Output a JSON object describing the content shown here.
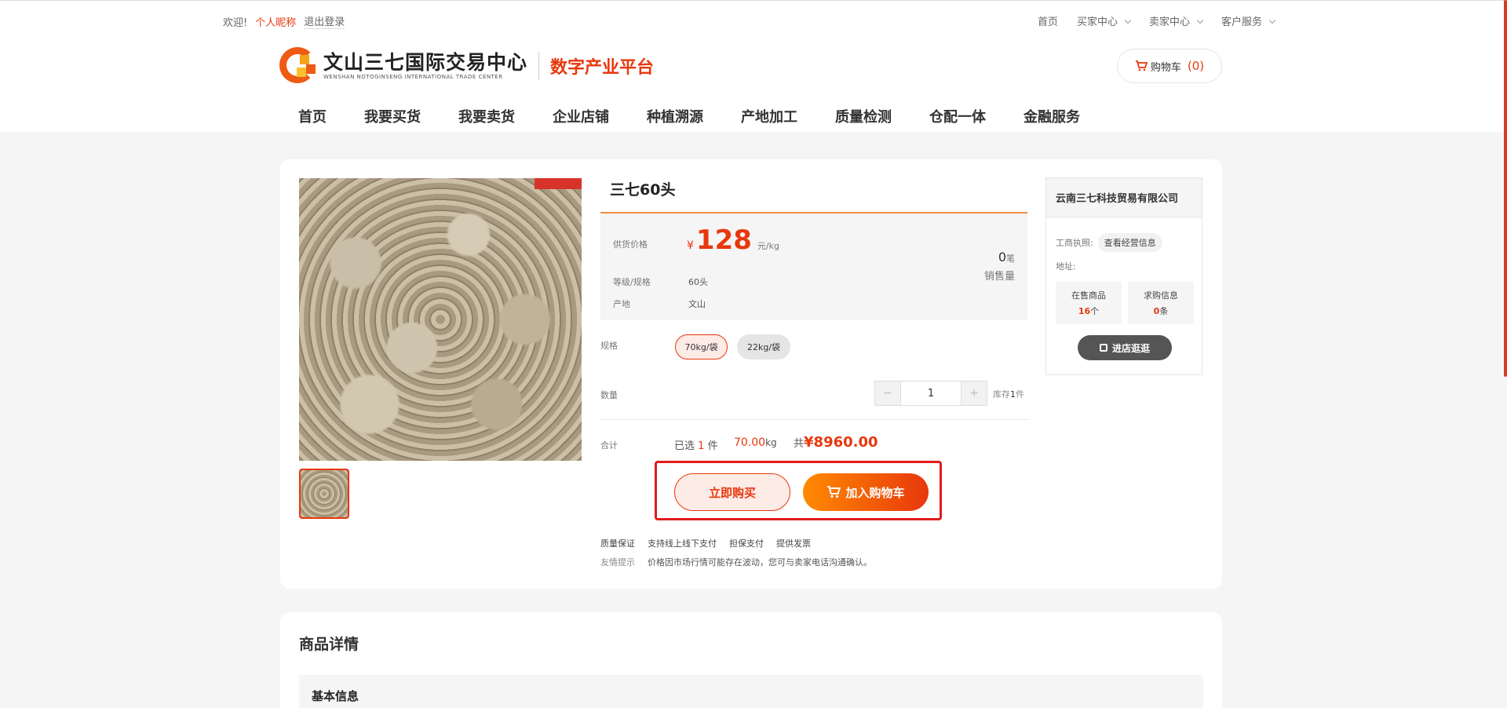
{
  "topbar": {
    "welcome": "欢迎!",
    "nickname": "个人昵称",
    "logout": "退出登录",
    "links": [
      "首页",
      "买家中心",
      "卖家中心",
      "客户服务"
    ]
  },
  "header": {
    "logo_cn": "文山三七国际交易中心",
    "logo_en": "WENSHAN NOTOGINSENG INTERNATIONAL TRADE CENTER",
    "platform": "数字产业平台",
    "cart_label": "购物车",
    "cart_count": "(0)"
  },
  "nav": [
    "首页",
    "我要买货",
    "我要卖货",
    "企业店铺",
    "种植溯源",
    "产地加工",
    "质量检测",
    "仓配一体",
    "金融服务"
  ],
  "product": {
    "title": "三七60头",
    "price_label": "供货价格",
    "price_symbol": "¥",
    "price": "128",
    "price_unit": "元/kg",
    "grade_label": "等级/规格",
    "grade_value": "60头",
    "origin_label": "产地",
    "origin_value": "文山",
    "sales_count": "0",
    "sales_unit": "笔",
    "sales_label": "销售量",
    "spec_label": "规格",
    "specs": [
      "70kg/袋",
      "22kg/袋"
    ],
    "qty_label": "数量",
    "qty_minus": "−",
    "qty_value": "1",
    "qty_plus": "+",
    "stock_prefix": "库存",
    "stock_value": "1",
    "stock_unit": "件",
    "total_label": "合计",
    "selected_prefix": "已选",
    "selected_count": "1",
    "selected_unit": "件",
    "weight": "70.00",
    "weight_unit": "kg",
    "total_prefix": "共",
    "total_value": "¥8960.00",
    "buy_now": "立即购买",
    "add_cart": "加入购物车",
    "guarantee_label": "质量保证",
    "guarantees": [
      "支持线上线下支付",
      "担保支付",
      "提供发票"
    ],
    "tips_label": "友情提示",
    "tips_text": "价格因市场行情可能存在波动，您可与卖家电话沟通确认。"
  },
  "shop": {
    "name": "云南三七科技贸易有限公司",
    "license_label": "工商执照:",
    "license_link": "查看经营信息",
    "address_label": "地址:",
    "on_sale_label": "在售商品",
    "on_sale_count": "16",
    "on_sale_unit": "个",
    "purchase_label": "求购信息",
    "purchase_count": "0",
    "purchase_unit": "条",
    "enter": "进店逛逛"
  },
  "detail": {
    "title": "商品详情",
    "basic": "基本信息"
  },
  "colors": {
    "accent": "#e8380d",
    "highlight_box": "#e21c1c"
  }
}
